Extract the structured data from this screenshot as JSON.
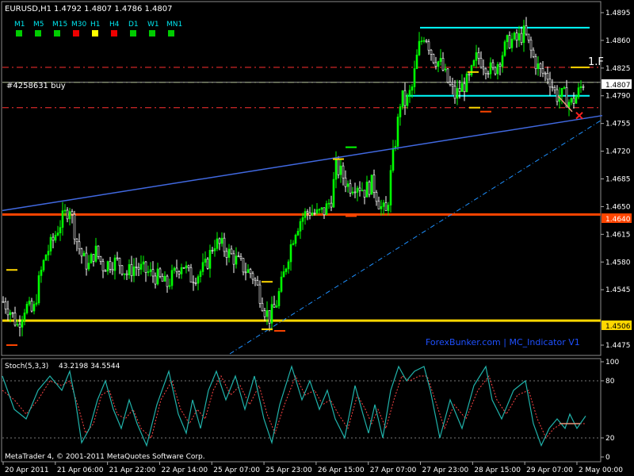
{
  "header": {
    "symbol_label": "EURUSD,H1",
    "ohlc_label": "1.4792 1.4807 1.4786 1.4807"
  },
  "timeframes": [
    {
      "label": "M1",
      "status": "up"
    },
    {
      "label": "M5",
      "status": "up"
    },
    {
      "label": "M15",
      "status": "up"
    },
    {
      "label": "M30",
      "status": "down"
    },
    {
      "label": "H1",
      "status": "neutral"
    },
    {
      "label": "H4",
      "status": "down"
    },
    {
      "label": "D1",
      "status": "up"
    },
    {
      "label": "W1",
      "status": "up"
    },
    {
      "label": "MN1",
      "status": "up"
    }
  ],
  "order_label": "#4258631 buy",
  "indicator_label": "ForexBunker.com | MC_Indicator V1",
  "stoch_header": {
    "name": "Stoch(5,3,3)",
    "values": "43.2198 34.5544"
  },
  "stoch_scale": [
    "100",
    "80",
    "20",
    "0"
  ],
  "copyright": "MetaTrader 4, © 2001-2011 MetaQuotes Software Corp.",
  "price_labels": {
    "current": "1.4807",
    "resistance": "1.4640",
    "support": "1.4506",
    "marker": "1.F"
  },
  "colors": {
    "bull": "#00ff00",
    "bear": "#ffffff",
    "grid": "#3a3a3a",
    "support": "#ffd700",
    "resistance": "#ff4500",
    "trend": "#4169e1",
    "range": "#00ffff",
    "stoch_main": "#20b2aa",
    "stoch_signal": "#ff4444",
    "tf_up": "#00cc00",
    "tf_down": "#ee0000",
    "tf_neutral": "#ffff00",
    "watermark": "#1e50ff"
  },
  "chart_data": {
    "type": "candlestick",
    "price_axis": {
      "range": [
        1.4464,
        1.4906
      ],
      "ticks": [
        "1.4895",
        "1.4860",
        "1.4825",
        "1.4790",
        "1.4755",
        "1.4720",
        "1.4685",
        "1.4650",
        "1.4615",
        "1.4580",
        "1.4545",
        "1.4475"
      ]
    },
    "time_axis": [
      "20 Apr 2011",
      "21 Apr 06:00",
      "21 Apr 22:00",
      "22 Apr 14:00",
      "25 Apr 07:00",
      "25 Apr 23:00",
      "26 Apr 15:00",
      "27 Apr 07:00",
      "27 Apr 23:00",
      "28 Apr 15:00",
      "29 Apr 07:00",
      "2 May 00:00"
    ],
    "close_path": [
      [
        0,
        1.4535
      ],
      [
        12,
        1.452
      ],
      [
        22,
        1.45
      ],
      [
        32,
        1.4525
      ],
      [
        42,
        1.4515
      ],
      [
        50,
        1.456
      ],
      [
        58,
        1.459
      ],
      [
        66,
        1.4605
      ],
      [
        74,
        1.4625
      ],
      [
        82,
        1.464
      ],
      [
        88,
        1.465
      ],
      [
        96,
        1.461
      ],
      [
        104,
        1.4585
      ],
      [
        112,
        1.4575
      ],
      [
        120,
        1.4595
      ],
      [
        130,
        1.4575
      ],
      [
        140,
        1.458
      ],
      [
        150,
        1.458
      ],
      [
        160,
        1.4565
      ],
      [
        170,
        1.4575
      ],
      [
        180,
        1.457
      ],
      [
        190,
        1.4565
      ],
      [
        200,
        1.456
      ],
      [
        210,
        1.455
      ],
      [
        220,
        1.4565
      ],
      [
        230,
        1.458
      ],
      [
        240,
        1.456
      ],
      [
        250,
        1.4565
      ],
      [
        260,
        1.4575
      ],
      [
        270,
        1.4605
      ],
      [
        280,
        1.46
      ],
      [
        290,
        1.459
      ],
      [
        300,
        1.458
      ],
      [
        310,
        1.457
      ],
      [
        318,
        1.4565
      ],
      [
        326,
        1.4545
      ],
      [
        334,
        1.452
      ],
      [
        340,
        1.451
      ],
      [
        348,
        1.4525
      ],
      [
        356,
        1.4555
      ],
      [
        364,
        1.459
      ],
      [
        372,
        1.462
      ],
      [
        380,
        1.4635
      ],
      [
        390,
        1.4645
      ],
      [
        400,
        1.464
      ],
      [
        410,
        1.4645
      ],
      [
        418,
        1.466
      ],
      [
        424,
        1.47
      ],
      [
        432,
        1.469
      ],
      [
        440,
        1.4675
      ],
      [
        450,
        1.468
      ],
      [
        460,
        1.467
      ],
      [
        470,
        1.468
      ],
      [
        480,
        1.465
      ],
      [
        488,
        1.464
      ],
      [
        494,
        1.47
      ],
      [
        500,
        1.474
      ],
      [
        506,
        1.479
      ],
      [
        512,
        1.478
      ],
      [
        520,
        1.48
      ],
      [
        528,
        1.485
      ],
      [
        536,
        1.487
      ],
      [
        546,
        1.484
      ],
      [
        556,
        1.483
      ],
      [
        566,
        1.4805
      ],
      [
        574,
        1.479
      ],
      [
        582,
        1.48
      ],
      [
        592,
        1.481
      ],
      [
        602,
        1.484
      ],
      [
        612,
        1.483
      ],
      [
        622,
        1.482
      ],
      [
        632,
        1.484
      ],
      [
        642,
        1.486
      ],
      [
        652,
        1.486
      ],
      [
        662,
        1.487
      ],
      [
        672,
        1.484
      ],
      [
        682,
        1.482
      ],
      [
        692,
        1.4815
      ],
      [
        702,
        1.479
      ],
      [
        712,
        1.479
      ],
      [
        720,
        1.478
      ],
      [
        728,
        1.479
      ],
      [
        736,
        1.4807
      ]
    ],
    "support": 1.4506,
    "resistance": 1.464,
    "range_top": 1.4876,
    "range_bottom": 1.479,
    "dash_levels": [
      {
        "value": 1.4826,
        "color": "#ff3030"
      },
      {
        "value": 1.4807,
        "color": "#9acd32"
      },
      {
        "value": 1.4775,
        "color": "#ff3030"
      }
    ],
    "trend_line": {
      "from": [
        0,
        1.4645
      ],
      "to": [
        760,
        1.4765
      ]
    },
    "dashdot_line": {
      "from": [
        290,
        1.4464
      ],
      "to": [
        760,
        1.476
      ]
    },
    "stochastic": {
      "range": [
        0,
        100
      ],
      "levels": [
        80,
        20
      ],
      "main": [
        [
          0,
          85
        ],
        [
          15,
          50
        ],
        [
          30,
          40
        ],
        [
          45,
          70
        ],
        [
          60,
          85
        ],
        [
          75,
          70
        ],
        [
          85,
          90
        ],
        [
          92,
          60
        ],
        [
          100,
          15
        ],
        [
          110,
          30
        ],
        [
          120,
          60
        ],
        [
          130,
          80
        ],
        [
          140,
          50
        ],
        [
          150,
          30
        ],
        [
          160,
          60
        ],
        [
          170,
          35
        ],
        [
          182,
          12
        ],
        [
          195,
          55
        ],
        [
          210,
          90
        ],
        [
          222,
          45
        ],
        [
          232,
          25
        ],
        [
          240,
          60
        ],
        [
          250,
          30
        ],
        [
          260,
          70
        ],
        [
          270,
          90
        ],
        [
          282,
          60
        ],
        [
          294,
          85
        ],
        [
          306,
          50
        ],
        [
          318,
          85
        ],
        [
          330,
          40
        ],
        [
          340,
          15
        ],
        [
          350,
          55
        ],
        [
          365,
          95
        ],
        [
          378,
          60
        ],
        [
          388,
          80
        ],
        [
          400,
          50
        ],
        [
          410,
          70
        ],
        [
          420,
          40
        ],
        [
          432,
          20
        ],
        [
          445,
          75
        ],
        [
          455,
          45
        ],
        [
          462,
          25
        ],
        [
          470,
          55
        ],
        [
          480,
          20
        ],
        [
          490,
          70
        ],
        [
          500,
          95
        ],
        [
          510,
          80
        ],
        [
          520,
          90
        ],
        [
          532,
          95
        ],
        [
          540,
          70
        ],
        [
          552,
          20
        ],
        [
          565,
          60
        ],
        [
          580,
          30
        ],
        [
          595,
          75
        ],
        [
          610,
          95
        ],
        [
          618,
          60
        ],
        [
          630,
          40
        ],
        [
          645,
          70
        ],
        [
          660,
          80
        ],
        [
          670,
          35
        ],
        [
          680,
          12
        ],
        [
          690,
          30
        ],
        [
          700,
          40
        ],
        [
          710,
          30
        ],
        [
          716,
          45
        ],
        [
          725,
          30
        ],
        [
          736,
          43
        ]
      ],
      "signal": [
        [
          0,
          70
        ],
        [
          15,
          60
        ],
        [
          30,
          45
        ],
        [
          45,
          60
        ],
        [
          60,
          80
        ],
        [
          75,
          75
        ],
        [
          85,
          80
        ],
        [
          95,
          55
        ],
        [
          105,
          25
        ],
        [
          115,
          35
        ],
        [
          125,
          65
        ],
        [
          135,
          70
        ],
        [
          145,
          45
        ],
        [
          155,
          40
        ],
        [
          165,
          50
        ],
        [
          175,
          30
        ],
        [
          188,
          20
        ],
        [
          200,
          60
        ],
        [
          214,
          80
        ],
        [
          225,
          50
        ],
        [
          236,
          35
        ],
        [
          246,
          50
        ],
        [
          256,
          40
        ],
        [
          266,
          70
        ],
        [
          276,
          85
        ],
        [
          288,
          65
        ],
        [
          300,
          75
        ],
        [
          312,
          55
        ],
        [
          324,
          75
        ],
        [
          334,
          45
        ],
        [
          344,
          25
        ],
        [
          356,
          55
        ],
        [
          370,
          85
        ],
        [
          382,
          65
        ],
        [
          394,
          70
        ],
        [
          404,
          55
        ],
        [
          414,
          60
        ],
        [
          424,
          45
        ],
        [
          436,
          30
        ],
        [
          448,
          65
        ],
        [
          458,
          50
        ],
        [
          466,
          35
        ],
        [
          474,
          50
        ],
        [
          484,
          30
        ],
        [
          494,
          60
        ],
        [
          504,
          85
        ],
        [
          514,
          80
        ],
        [
          526,
          85
        ],
        [
          536,
          85
        ],
        [
          546,
          60
        ],
        [
          558,
          30
        ],
        [
          570,
          55
        ],
        [
          585,
          40
        ],
        [
          600,
          70
        ],
        [
          614,
          85
        ],
        [
          624,
          60
        ],
        [
          636,
          45
        ],
        [
          650,
          65
        ],
        [
          664,
          70
        ],
        [
          675,
          40
        ],
        [
          686,
          20
        ],
        [
          696,
          30
        ],
        [
          706,
          35
        ],
        [
          716,
          35
        ],
        [
          728,
          35
        ],
        [
          736,
          35
        ]
      ]
    }
  }
}
